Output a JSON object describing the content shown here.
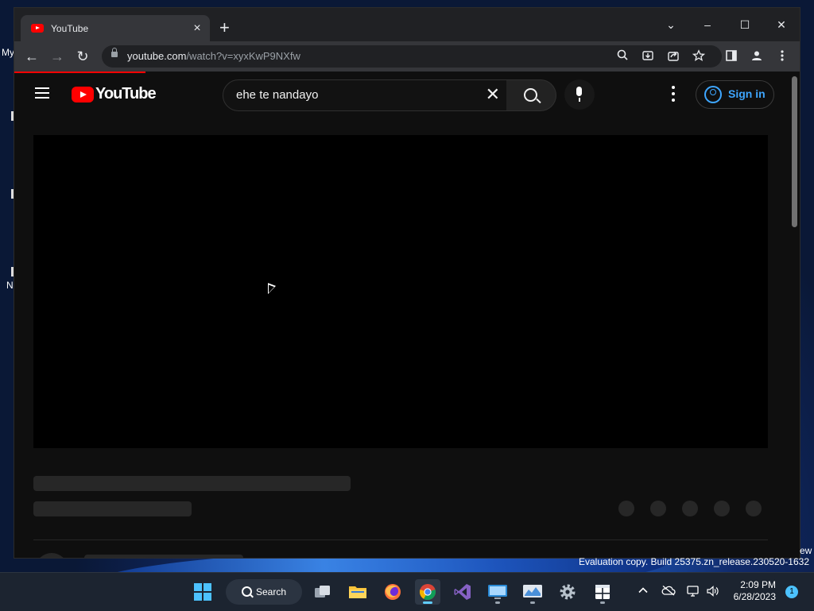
{
  "desktop": {
    "fragments": {
      "my": "My",
      "n": "N",
      "ew": "ew"
    },
    "watermark": "Evaluation copy. Build 25375.zn_release.230520-1632"
  },
  "browser": {
    "tab": {
      "title": "YouTube",
      "close_glyph": "×"
    },
    "new_tab_glyph": "+",
    "window_controls": {
      "dropdown": "⌄",
      "minimize": "–",
      "maximize": "☐",
      "close": "✕"
    },
    "address": {
      "host": "youtube.com",
      "path": "/watch?v=xyxKwP9NXfw"
    },
    "nav": {
      "back": "←",
      "forward": "→",
      "reload": "↻"
    }
  },
  "youtube": {
    "logo_text": "YouTube",
    "search": {
      "query": "ehe te nandayo",
      "clear_glyph": "✕"
    },
    "signin_label": "Sign in"
  },
  "taskbar": {
    "search_label": "Search",
    "clock": {
      "time": "2:09 PM",
      "date": "6/28/2023"
    },
    "notification_count": "1",
    "colors": {
      "accent": "#4cc2ff",
      "active": "#60cdff"
    }
  }
}
